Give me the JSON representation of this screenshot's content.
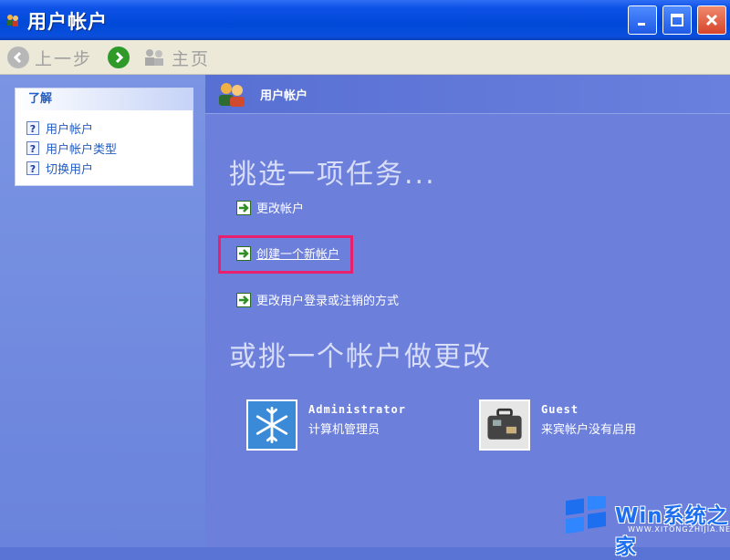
{
  "window": {
    "title": "用户帐户",
    "accent": "#0049d8"
  },
  "toolbar": {
    "back_label": "上一步",
    "home_label": "主页"
  },
  "learn": {
    "heading": "了解",
    "items": [
      {
        "label": "用户帐户",
        "icon": "help-icon"
      },
      {
        "label": "用户帐户类型",
        "icon": "help-icon"
      },
      {
        "label": "切换用户",
        "icon": "help-icon"
      }
    ]
  },
  "main": {
    "header_title": "用户帐户",
    "pick_task": "挑选一项任务...",
    "tasks": [
      {
        "label": "更改帐户",
        "icon": "green-arrow-icon"
      },
      {
        "label": "创建一个新帐户",
        "icon": "green-arrow-icon",
        "highlighted": true
      },
      {
        "label": "更改用户登录或注销的方式",
        "icon": "green-arrow-icon"
      }
    ],
    "pick_account": "或挑一个帐户做更改",
    "accounts": [
      {
        "name": "Administrator",
        "description": "计算机管理员",
        "picture": "snowflake-icon"
      },
      {
        "name": "Guest",
        "description": "来宾帐户没有启用",
        "picture": "suitcase-icon"
      }
    ]
  },
  "watermark": {
    "text": "Win系统之家",
    "sub": "WWW.XITONGZHIJIA.NET"
  }
}
